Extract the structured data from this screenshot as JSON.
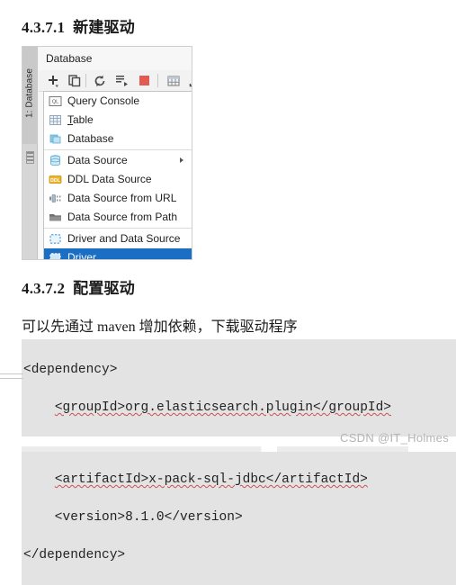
{
  "document": {
    "headings": [
      {
        "number": "4.3.7.1",
        "text": "新建驱动"
      },
      {
        "number": "4.3.7.2",
        "text": "配置驱动"
      }
    ],
    "paragraph": "可以先通过 maven 增加依赖，下载驱动程序"
  },
  "ide_panel": {
    "tool_window_label": "1: Database",
    "title": "Database",
    "toolbar": [
      {
        "name": "add-icon",
        "tooltip": "Add"
      },
      {
        "name": "duplicate-icon",
        "tooltip": "Duplicate"
      },
      {
        "name": "refresh-icon",
        "tooltip": "Refresh"
      },
      {
        "name": "run-query-icon",
        "tooltip": "Jump to Query Console"
      },
      {
        "name": "stop-icon",
        "tooltip": "Stop"
      },
      {
        "name": "table-icon",
        "tooltip": "Data Editor"
      },
      {
        "name": "export-icon",
        "tooltip": "Export"
      }
    ],
    "menu_items": [
      {
        "icon": "query-console-icon",
        "label": "Query Console",
        "mnemonic": "",
        "selected": false,
        "submenu": false
      },
      {
        "icon": "table-grid-icon",
        "label": "Table",
        "mnemonic": "T",
        "selected": false,
        "submenu": false
      },
      {
        "icon": "database-icon",
        "label": "Database",
        "mnemonic": "",
        "selected": false,
        "submenu": false
      },
      {
        "icon": "data-source-icon",
        "label": "Data Source",
        "mnemonic": "",
        "selected": false,
        "submenu": true
      },
      {
        "icon": "ddl-icon",
        "label": "DDL Data Source",
        "mnemonic": "",
        "selected": false,
        "submenu": false
      },
      {
        "icon": "url-icon",
        "label": "Data Source from URL",
        "mnemonic": "",
        "selected": false,
        "submenu": false
      },
      {
        "icon": "folder-icon",
        "label": "Data Source from Path",
        "mnemonic": "",
        "selected": false,
        "submenu": false
      },
      {
        "icon": "driver-icon",
        "label": "Driver and Data Source",
        "mnemonic": "",
        "selected": false,
        "submenu": false
      },
      {
        "icon": "driver-icon",
        "label": "Driver",
        "mnemonic": "",
        "selected": true,
        "submenu": false
      }
    ],
    "colors": {
      "selection": "#1a6ec4",
      "panel_background": "#f2f2f2",
      "menu_background": "#ffffff",
      "stop_button": "#e05c52"
    }
  },
  "code_block": {
    "language": "xml",
    "background": "#e3e3e3",
    "lines": [
      "<dependency>",
      "    <groupId>org.elasticsearch.plugin</groupId>",
      "",
      "    <artifactId>x-pack-sql-jdbc</artifactId>",
      "    <version>8.1.0</version>",
      "</dependency>"
    ],
    "line_1": "<dependency>",
    "line_2_indent": "    ",
    "line_2_open": "<groupId>",
    "line_2_value": "org.elasticsearch.plugin",
    "line_2_close": "</groupId>",
    "line_4_indent": "    ",
    "line_4_open": "<artifactId>",
    "line_4_value": "x-pack-sql-jdbc",
    "line_4_close": "</artifactId>",
    "line_5": "    <version>8.1.0</version>",
    "line_6": "</dependency>"
  },
  "watermark": {
    "text": "CSDN @IT_Holmes"
  }
}
